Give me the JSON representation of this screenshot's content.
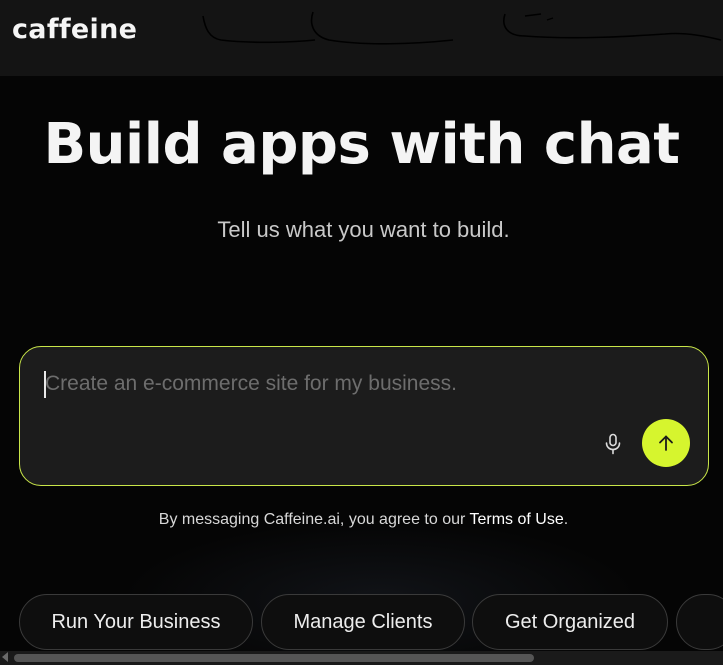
{
  "header": {
    "logo_text": "caffeine"
  },
  "hero": {
    "title": "Build apps with chat",
    "subtitle": "Tell us what you want to build."
  },
  "prompt": {
    "value": "",
    "placeholder": "Create an e-commerce site for my business.",
    "mic_icon": "microphone-icon",
    "send_icon": "arrow-up-icon"
  },
  "terms": {
    "prefix": "By messaging Caffeine.ai, you agree to our ",
    "link": "Terms of Use",
    "suffix": "."
  },
  "suggestions": [
    {
      "label": "Run Your Business"
    },
    {
      "label": "Manage Clients"
    },
    {
      "label": "Get Organized"
    }
  ],
  "colors": {
    "accent": "#d6f52e",
    "background": "#050505",
    "input_border": "#c9e649"
  }
}
